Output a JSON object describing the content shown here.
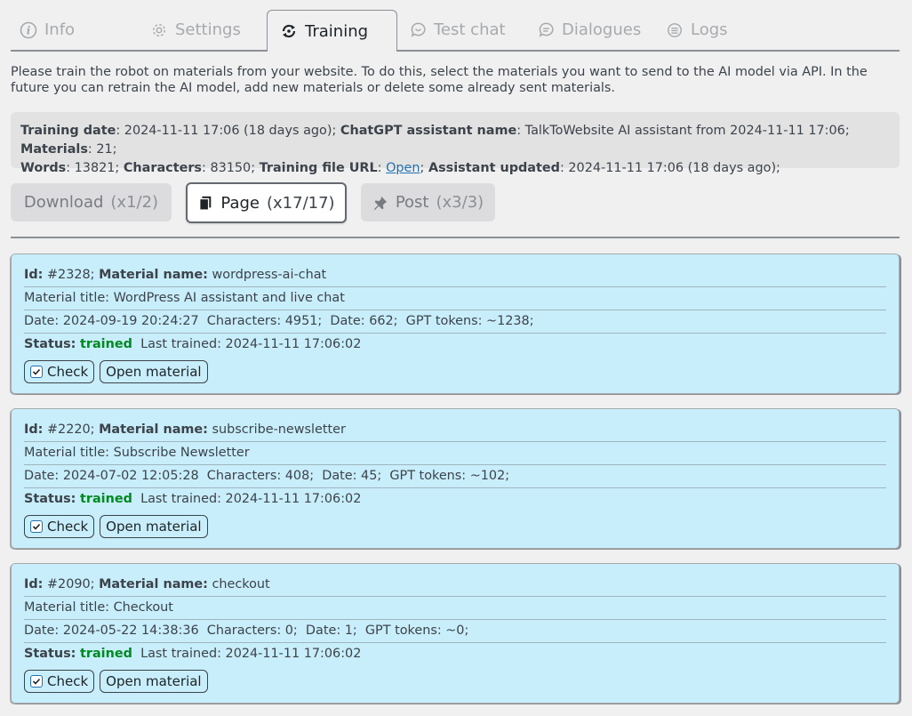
{
  "tabs": [
    {
      "label": "Info",
      "icon": "info-icon"
    },
    {
      "label": "Settings",
      "icon": "gear-icon"
    },
    {
      "label": "Training",
      "icon": "training-icon",
      "active": true
    },
    {
      "label": "Test chat",
      "icon": "chat-bubble-icon"
    },
    {
      "label": "Dialogues",
      "icon": "dialogues-icon"
    },
    {
      "label": "Logs",
      "icon": "logs-icon"
    }
  ],
  "intro": "Please train the robot on materials from your website. To do this, select the materials you want to send to the AI model via API. In the future you can retrain the AI model, add new materials or delete some already sent materials.",
  "info": {
    "training_date_label": "Training date",
    "training_date": ": 2024-11-11 17:06 (18 days ago); ",
    "assistant_label": "ChatGPT assistant name",
    "assistant": ": TalkToWebsite AI assistant from 2024-11-11 17:06; ",
    "materials_label": "Materials",
    "materials": ": 21;",
    "words_label": "Words",
    "words": ": 13821; ",
    "characters_label": "Characters",
    "characters": ": 83150; ",
    "file_url_label": "Training file URL",
    "file_url_sep": ": ",
    "file_url_link": "Open",
    "file_url_end": "; ",
    "updated_label": "Assistant updated",
    "updated": ": 2024-11-11 17:06 (18 days ago);"
  },
  "buttons": {
    "download": {
      "label": "Download",
      "count": "(x1/2)"
    },
    "page": {
      "label": "Page",
      "count": "(x17/17)"
    },
    "post": {
      "label": "Post",
      "count": "(x3/3)"
    }
  },
  "labels": {
    "id": "Id:",
    "material_name": "Material name:",
    "status": "Status:",
    "check": "Check",
    "open_material": "Open material"
  },
  "materials": [
    {
      "id": " #2328; ",
      "name": " wordpress-ai-chat",
      "title": "Material title: WordPress AI assistant and live chat",
      "meta": "Date: 2024-09-19 20:24:27  Characters: 4951;  Date: 662;  GPT tokens: ~1238;",
      "status": "trained",
      "last_trained": "Last trained: 2024-11-11 17:06:02"
    },
    {
      "id": " #2220; ",
      "name": " subscribe-newsletter",
      "title": "Material title: Subscribe Newsletter",
      "meta": "Date: 2024-07-02 12:05:28  Characters: 408;  Date: 45;  GPT tokens: ~102;",
      "status": "trained",
      "last_trained": "Last trained: 2024-11-11 17:06:02"
    },
    {
      "id": " #2090; ",
      "name": " checkout",
      "title": "Material title: Checkout",
      "meta": "Date: 2024-05-22 14:38:36  Characters: 0;  Date: 1;  GPT tokens: ~0;",
      "status": "trained",
      "last_trained": "Last trained: 2024-11-11 17:06:02"
    }
  ],
  "colors": {
    "card_bg": "#c8eefb",
    "trained": "#008a20",
    "link": "#2271b1"
  }
}
